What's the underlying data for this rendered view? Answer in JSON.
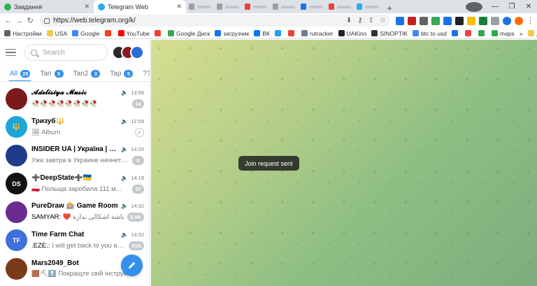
{
  "browser": {
    "tabs": [
      {
        "title": "Завдання",
        "active": false,
        "color": "#2bb24c"
      },
      {
        "title": "Telegram Web",
        "active": true,
        "color": "#2aabee"
      }
    ],
    "url": "https://web.telegram.org/k/",
    "bookmarks": [
      {
        "label": "Настройки",
        "color": "#5f6368"
      },
      {
        "label": "USA",
        "color": "#f2c94c"
      },
      {
        "label": "Google",
        "color": "#4285f4"
      },
      {
        "label": "",
        "color": "#fc3f1d"
      },
      {
        "label": "YouTube",
        "color": "#ff0000"
      },
      {
        "label": "",
        "color": "#ea4335"
      },
      {
        "label": "Google Диск",
        "color": "#34a853"
      },
      {
        "label": "загрузчик",
        "color": "#1a73e8"
      },
      {
        "label": "ВК",
        "color": "#0077ff"
      },
      {
        "label": "",
        "color": "#1da1f2"
      },
      {
        "label": "",
        "color": "#e8453c"
      },
      {
        "label": "rutracker",
        "color": "#6b7f93"
      },
      {
        "label": "UAKino",
        "color": "#222222"
      },
      {
        "label": "SINOPTIK",
        "color": "#333333"
      },
      {
        "label": "btc to usd",
        "color": "#4285f4"
      },
      {
        "label": "",
        "color": "#1a73e8"
      },
      {
        "label": "",
        "color": "#e8453c"
      },
      {
        "label": "",
        "color": "#34a853"
      },
      {
        "label": "maps",
        "color": "#34a853"
      }
    ],
    "other_bookmarks": "Другие закладки",
    "more_bookmarks": "»"
  },
  "telegram": {
    "search_placeholder": "Search",
    "folders": [
      {
        "label": "All",
        "count": "28",
        "active": true
      },
      {
        "label": "Tan",
        "count": "5",
        "active": false
      },
      {
        "label": "Tan2",
        "count": "3",
        "active": false
      },
      {
        "label": "Tap",
        "count": "5",
        "active": false
      },
      {
        "label": "??",
        "count": "",
        "active": false
      }
    ],
    "chats": [
      {
        "name": "𝓐𝓭𝓮𝓵𝓲𝓼𝓲𝔂𝓪 𝓜𝓾𝓼𝓲𝓬",
        "time": "13:55",
        "sender": "",
        "preview": "🥀🥀🥀🥀🥀🥀🥀🥀",
        "badge": "14",
        "pinned": false,
        "avatar": "#7a1a1a",
        "avatar_text": ""
      },
      {
        "name": "Тризуб🔱",
        "time": "12:59",
        "sender": "",
        "preview": "🖼 Album",
        "badge": "",
        "pinned": true,
        "avatar": "#1ea7d6",
        "avatar_text": "🔱"
      },
      {
        "name": "INSIDER UA | Україна | Новини",
        "time": "14:20",
        "sender": "",
        "preview": "Уже завтра в Украине начнется...",
        "badge": "9",
        "pinned": false,
        "avatar": "#1f3b8a",
        "avatar_text": ""
      },
      {
        "name": "➕DeepState➕🇺🇦",
        "time": "14:19",
        "sender": "",
        "preview": "🇵🇱 Польща заробила 111 м...",
        "badge": "37",
        "pinned": false,
        "avatar": "#111111",
        "avatar_text": "DS"
      },
      {
        "name": "PureDraw 🎰 Game Room",
        "time": "14:32",
        "sender": "SAMYAR:",
        "preview": "❤️ باشه اشکالی نداره",
        "badge": "8.9K",
        "pinned": false,
        "avatar": "#6a2c91",
        "avatar_text": ""
      },
      {
        "name": "Time Farm Chat",
        "time": "14:32",
        "sender": ".EZE.:",
        "preview": "I will get back to you as s...",
        "badge": "41K",
        "pinned": false,
        "avatar": "#3f6fd8",
        "avatar_text": "TF"
      },
      {
        "name": "Mars2049_Bot",
        "time": "",
        "sender": "",
        "preview": "🟫⛏⬆️ Покращте свій інструм...",
        "badge": "",
        "pinned": false,
        "avatar": "#7a3b1a",
        "avatar_text": ""
      }
    ],
    "toast": "Join request sent"
  }
}
